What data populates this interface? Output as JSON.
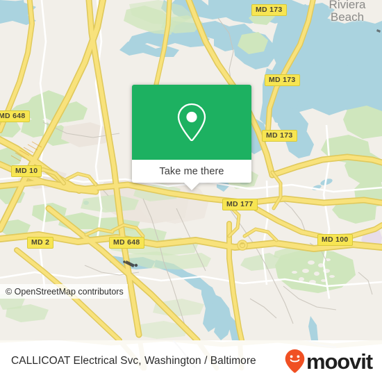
{
  "map": {
    "provider_attribution": "© OpenStreetMap contributors",
    "place_labels": [
      {
        "name": "Riviera Beach",
        "text": "Riviera\nBeach"
      }
    ],
    "road_shields": [
      {
        "id": "md-173-top",
        "label": "MD 173"
      },
      {
        "id": "md-173-mid",
        "label": "MD 173"
      },
      {
        "id": "md-173-right",
        "label": "MD 173"
      },
      {
        "id": "md-648-left",
        "label": "MD 648"
      },
      {
        "id": "md-10",
        "label": "MD 10"
      },
      {
        "id": "md-2",
        "label": "MD 2"
      },
      {
        "id": "md-648-bottom",
        "label": "MD 648"
      },
      {
        "id": "md-177",
        "label": "MD 177"
      },
      {
        "id": "md-100",
        "label": "MD 100"
      }
    ],
    "colors": {
      "land": "#f2efe9",
      "water": "#aad3df",
      "park": "#cfe6bd",
      "residential": "#ece5dd",
      "road_fill": "#f7e06e",
      "road_casing": "#e3c85e",
      "minor_road": "#ffffff",
      "track": "#c9c4bb",
      "shield_bg": "#f7e552",
      "shield_border": "#d8c93a"
    }
  },
  "popup": {
    "icon": "location-pin-icon",
    "action_label": "Take me there",
    "header_color": "#1db161"
  },
  "footer": {
    "title": "CALLICOAT Electrical Svc, Washington / Baltimore",
    "brand_name": "moovit",
    "brand_icon": "moovit-smiley-pin-icon",
    "brand_color": "#f05023",
    "wordmark_color": "#1f1f1f"
  }
}
